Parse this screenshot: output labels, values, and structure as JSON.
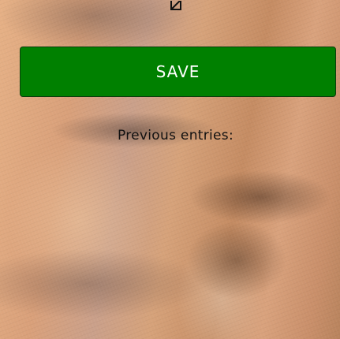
{
  "icons": {
    "top": "edit-icon"
  },
  "actions": {
    "save_label": "SAVE"
  },
  "entries": {
    "heading": "Previous entries:"
  },
  "colors": {
    "save_button_bg": "#008000",
    "save_button_text": "#ffffff",
    "heading_text": "#111111"
  }
}
